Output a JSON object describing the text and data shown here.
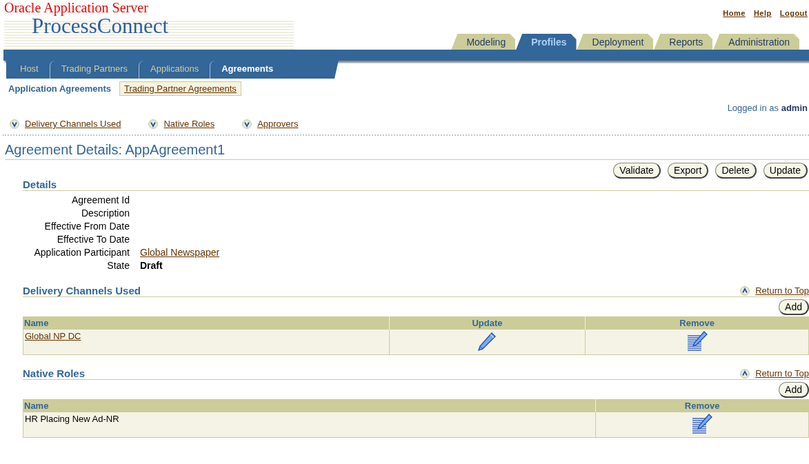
{
  "header": {
    "brand": "Oracle Application Server",
    "product": "ProcessConnect"
  },
  "global_links": [
    "Home",
    "Help",
    "Logout"
  ],
  "main_tabs": [
    {
      "label": "Modeling",
      "selected": false
    },
    {
      "label": "Profiles",
      "selected": true
    },
    {
      "label": "Deployment",
      "selected": false
    },
    {
      "label": "Reports",
      "selected": false
    },
    {
      "label": "Administration",
      "selected": false
    }
  ],
  "sub_tabs": [
    {
      "label": "Host",
      "selected": false
    },
    {
      "label": "Trading Partners",
      "selected": false
    },
    {
      "label": "Applications",
      "selected": false
    },
    {
      "label": "Agreements",
      "selected": true
    }
  ],
  "level3_tabs": [
    {
      "label": "Application Agreements",
      "selected": true
    },
    {
      "label": "Trading Partner Agreements",
      "selected": false
    }
  ],
  "user_info": "Logged in as **admin**",
  "quick_links": [
    "Delivery Channels Used",
    "Native Roles",
    "Approvers"
  ],
  "page_title": "Agreement Details: AppAgreement1",
  "actions": [
    "Validate",
    "Export",
    "Delete",
    "Update"
  ],
  "details": {
    "title": "Details",
    "fields": [
      {
        "label": "Agreement Id"
      },
      {
        "label": "Description"
      },
      {
        "label": "Effective From Date"
      },
      {
        "label": "Effective To Date"
      },
      {
        "label": "Application Participant",
        "value": "Global Newspaper",
        "kind": "link"
      },
      {
        "label": "State",
        "value": "Draft",
        "kind": "bold"
      }
    ]
  },
  "sections": [
    {
      "title": "Delivery Channels Used",
      "return_link": "Return to Top",
      "add_button": "Add",
      "columns": [
        "Name",
        "Update",
        "Remove"
      ],
      "rows": [
        {
          "cells": [
            {
              "kind": "link",
              "text": "Global NP DC"
            },
            {
              "kind": "pencil"
            },
            {
              "kind": "note-pencil"
            }
          ]
        }
      ]
    },
    {
      "title": "Native Roles",
      "return_link": "Return to Top",
      "add_button": "Add",
      "columns": [
        "Name",
        "Remove"
      ],
      "rows": [
        {
          "cells": [
            {
              "kind": "text",
              "text": "HR Placing New Ad-NR"
            },
            {
              "kind": "note-pencil"
            }
          ]
        }
      ]
    }
  ]
}
